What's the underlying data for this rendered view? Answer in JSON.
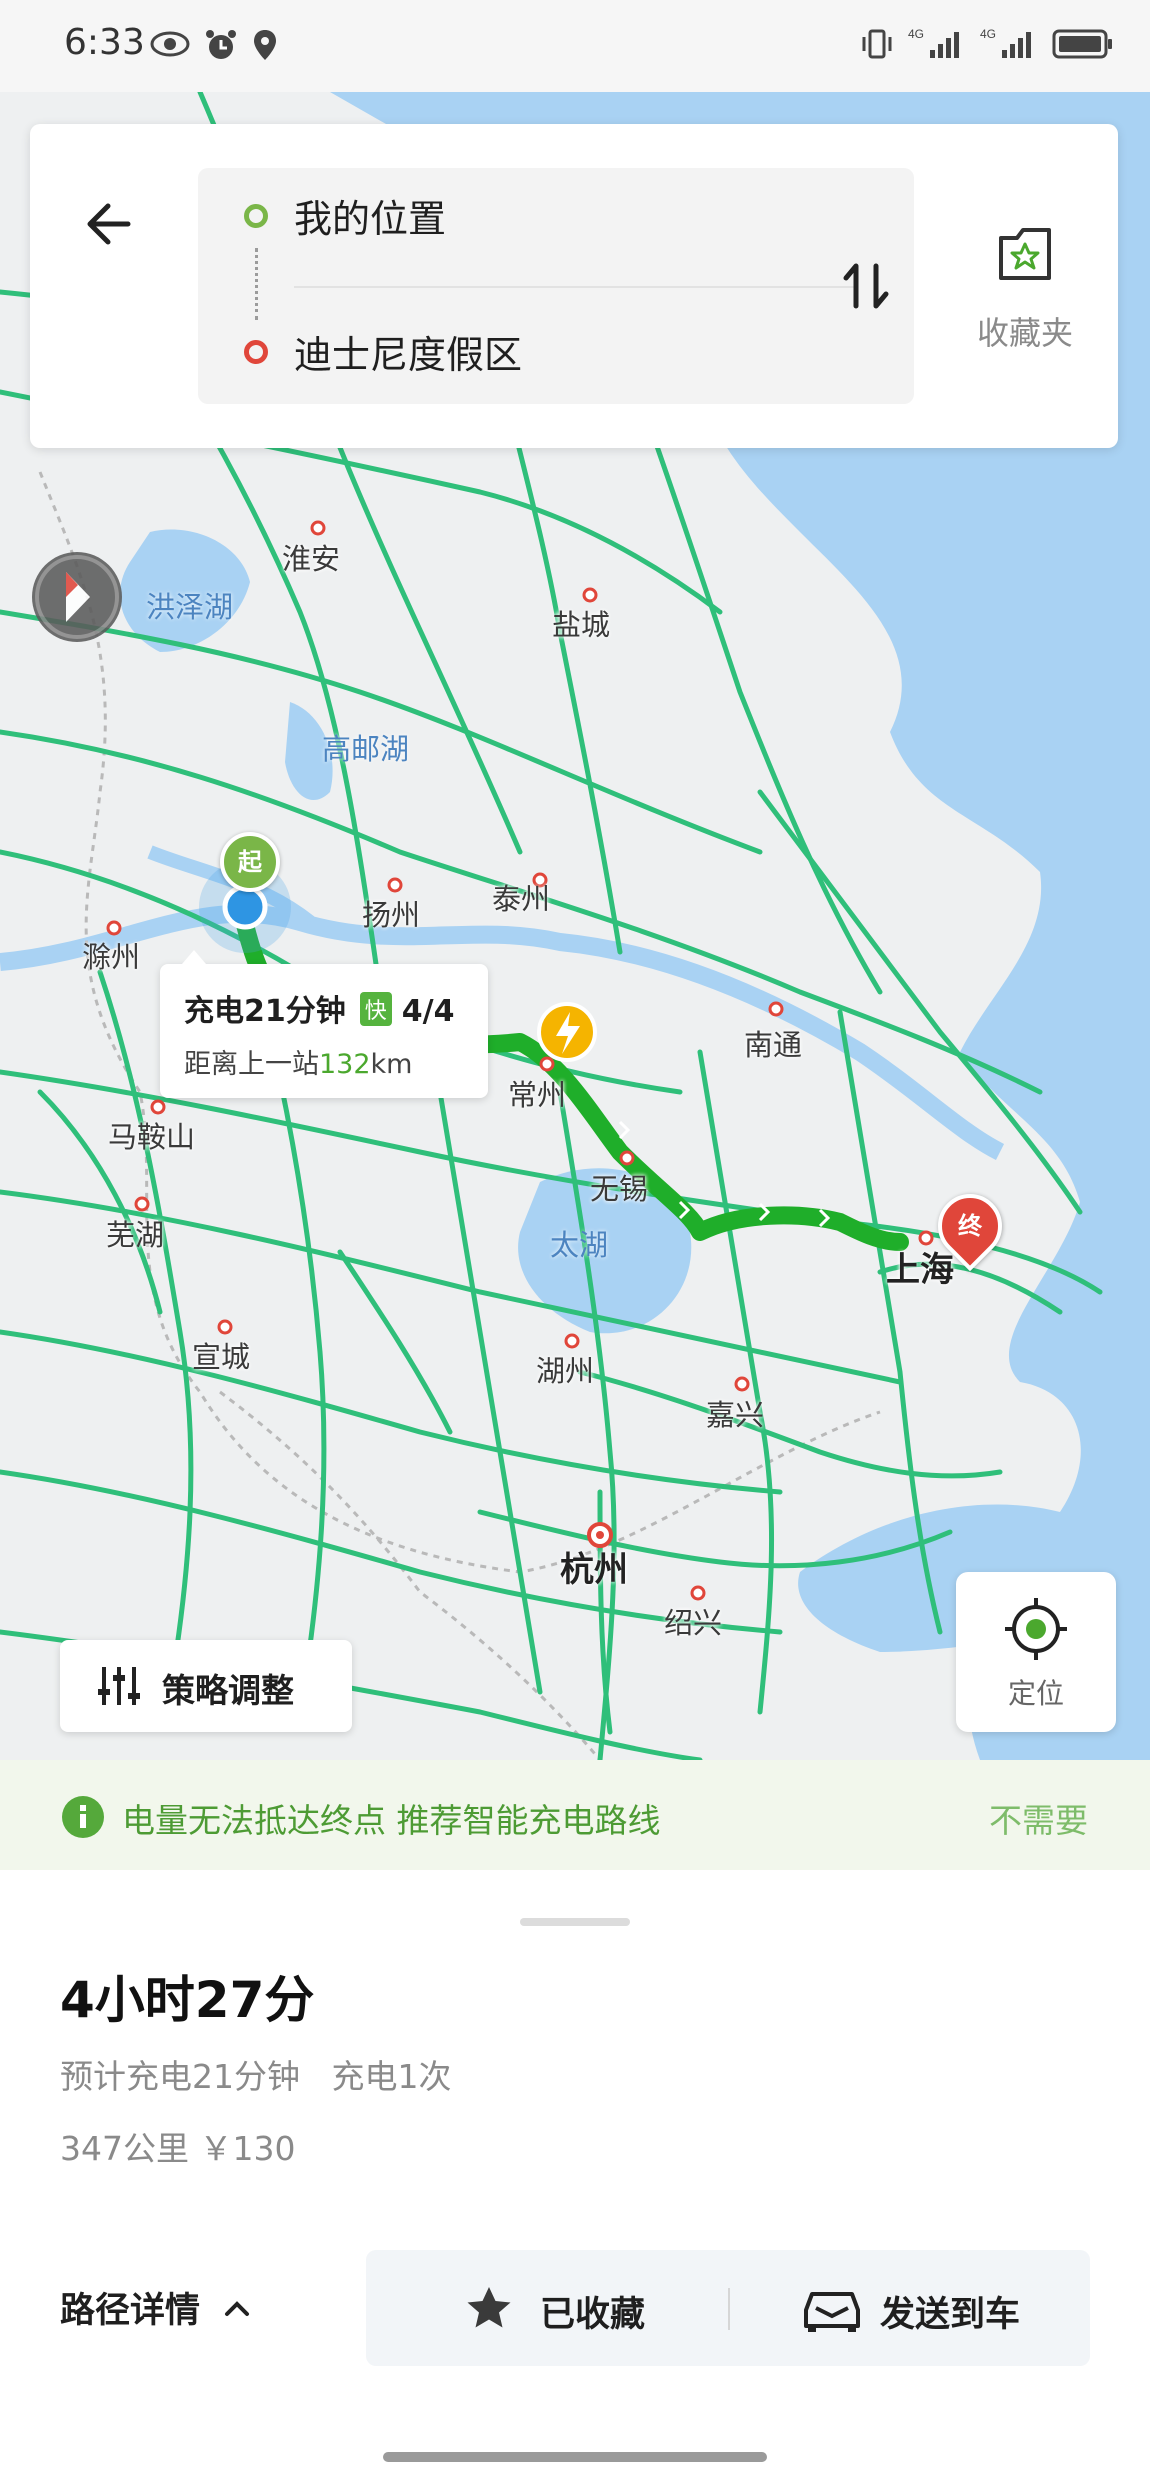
{
  "status_bar": {
    "time": "6:33",
    "network_labels": [
      "4G",
      "4G"
    ]
  },
  "search": {
    "origin": "我的位置",
    "destination": "迪士尼度假区",
    "favorites_label": "收藏夹"
  },
  "map": {
    "labels": {
      "huaian": "淮安",
      "yancheng": "盐城",
      "hongze": "洪泽湖",
      "gaoyou": "高邮湖",
      "chuzhou": "滁州",
      "yangzhou": "扬州",
      "taizhou": "泰州",
      "maanshan": "马鞍山",
      "nantong": "南通",
      "changzhou": "常州",
      "wuxi": "无锡",
      "wuhu": "芜湖",
      "taihu": "太湖",
      "shanghai": "上海",
      "xuancheng": "宣城",
      "huzhou": "湖州",
      "jiaxing": "嘉兴",
      "hangzhou": "杭州",
      "shaoxing": "绍兴"
    },
    "start_marker": "起",
    "end_marker": "终",
    "charging_callout": {
      "title": "充电21分钟",
      "fast_badge": "快",
      "progress": "4/4",
      "distance_prefix": "距离上一站",
      "distance_value": "132",
      "distance_unit": "km"
    },
    "strategy_button": "策略调整",
    "locate_button": "定位"
  },
  "warning": {
    "message": "电量无法抵达终点 推荐智能充电路线",
    "action": "不需要"
  },
  "summary": {
    "duration": "4小时27分",
    "charge_info": "预计充电21分钟   充电1次",
    "distance_cost": "347公里 ￥130",
    "details_label": "路径详情",
    "favorited_label": "已收藏",
    "send_to_car_label": "发送到车"
  },
  "colors": {
    "route": "#1fae2a",
    "highway": "#2fbf7a",
    "water": "#a9d2f3",
    "accent_green": "#4d9b34",
    "start_dot": "#7ab648",
    "end_dot": "#e0463a"
  }
}
